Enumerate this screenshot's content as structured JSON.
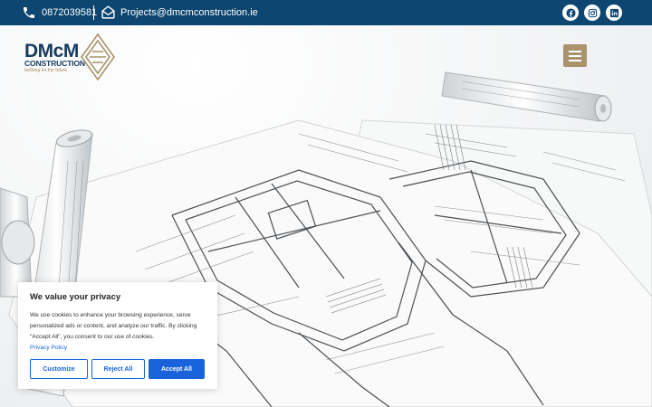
{
  "topbar": {
    "phone": "0872039581",
    "email": "Projects@dmcmconstruction.ie",
    "social": [
      {
        "name": "facebook-icon"
      },
      {
        "name": "instagram-icon"
      },
      {
        "name": "linkedin-icon"
      }
    ]
  },
  "logo": {
    "brand": "DMcM",
    "sub": "CONSTRUCTION",
    "tagline": "building for the future"
  },
  "cookie": {
    "title": "We value your privacy",
    "text": "We use cookies to enhance your browsing experience, serve personalized ads or content, and analyze our traffic. By clicking \"Accept All\", you consent to our use of cookies.",
    "policy_link": "Privacy Policy",
    "customize": "Customize",
    "reject": "Reject All",
    "accept": "Accept All"
  },
  "colors": {
    "topbar": "#0d4670",
    "brand_navy": "#163c5f",
    "brand_gold": "#a8936d",
    "cookie_accent": "#1863dc"
  }
}
